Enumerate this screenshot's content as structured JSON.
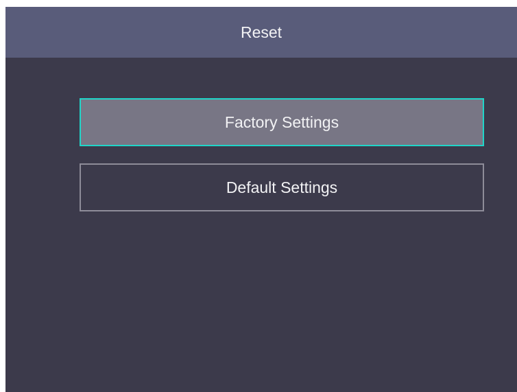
{
  "header": {
    "title": "Reset"
  },
  "menu": {
    "items": [
      {
        "label": "Factory Settings",
        "selected": true
      },
      {
        "label": "Default Settings",
        "selected": false
      }
    ]
  },
  "colors": {
    "background": "#3c3a4b",
    "header_bg": "#595c7a",
    "selected_bg": "#787685",
    "selected_border": "#20d6c9",
    "normal_border": "#8e8c99",
    "text": "#f2f2f4"
  }
}
